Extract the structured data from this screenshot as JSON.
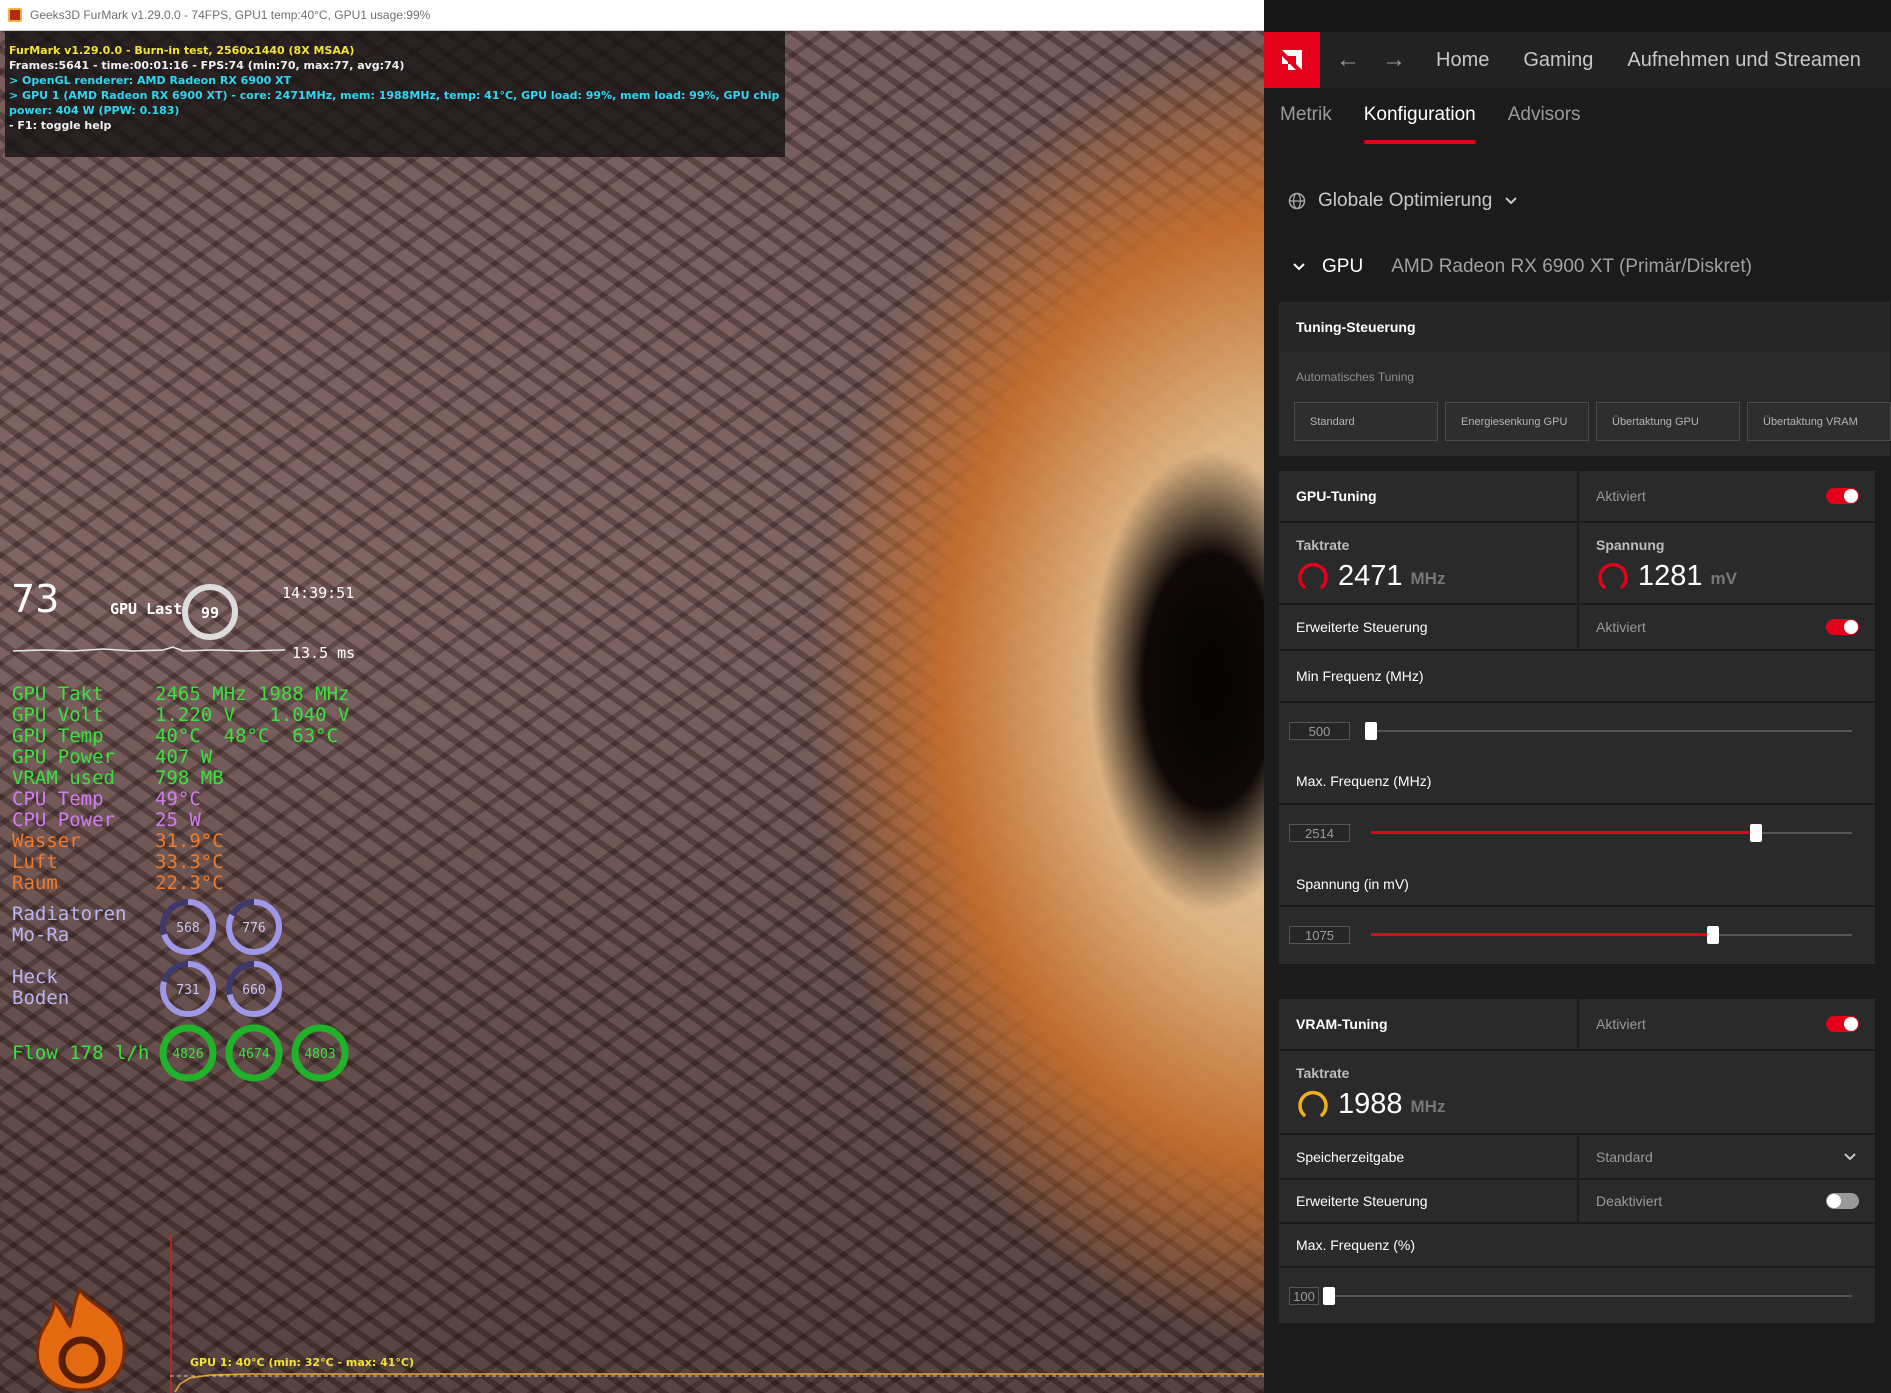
{
  "furmark": {
    "window_title": "Geeks3D FurMark v1.29.0.0 - 74FPS, GPU1 temp:40°C, GPU1 usage:99%",
    "info_lines": [
      {
        "text": "FurMark v1.29.0.0 - Burn-in test, 2560x1440 (8X MSAA)",
        "color": "#f2e33a"
      },
      {
        "text": "Frames:5641 - time:00:01:16 - FPS:74 (min:70, max:77, avg:74)",
        "color": "#f0f0f0"
      },
      {
        "text": "> OpenGL renderer: AMD Radeon RX 6900 XT",
        "color": "#31d6ef"
      },
      {
        "text": "> GPU 1 (AMD Radeon RX 6900 XT) - core: 2471MHz, mem: 1988MHz, temp: 41°C, GPU load: 99%, mem load: 99%, GPU chip power: 404 W (PPW: 0.183)",
        "color": "#31d6ef"
      },
      {
        "text": "- F1: toggle help",
        "color": "#f0f0f0"
      }
    ],
    "graph_label": "GPU 1: 40°C (min: 32°C - max: 41°C)"
  },
  "osd": {
    "fps": "73",
    "gpu_last_label": "GPU Last",
    "gpu_last_value": "99",
    "gpu_last_fraction": 0.99,
    "clock": "14:39:51",
    "frametime": "13.5 ms",
    "rows": [
      {
        "label": "GPU Takt",
        "value": "2465 MHz 1988 MHz",
        "color": "#39e23f"
      },
      {
        "label": "GPU Volt",
        "value": "1.220 V   1.040 V",
        "color": "#39e23f"
      },
      {
        "label": "GPU Temp",
        "value": "40°C  48°C  63°C",
        "color": "#39e23f"
      },
      {
        "label": "GPU Power",
        "value": "407 W",
        "color": "#39e23f"
      },
      {
        "label": "VRAM used",
        "value": "798 MB",
        "color": "#39e23f"
      },
      {
        "label": "CPU Temp",
        "value": "49°C",
        "color": "#d27df2"
      },
      {
        "label": "CPU Power",
        "value": "25 W",
        "color": "#d27df2"
      },
      {
        "label": "Wasser",
        "value": "31.9°C",
        "color": "#f07a2a"
      },
      {
        "label": "Luft",
        "value": "33.3°C",
        "color": "#f07a2a"
      },
      {
        "label": "Raum",
        "value": "22.3°C",
        "color": "#f07a2a"
      }
    ],
    "radiators_label_1": "Radiatoren",
    "radiators_label_2": "Mo-Ra",
    "rad_gauge_1": "568",
    "rad_gauge_2": "776",
    "heck_label": "Heck",
    "boden_label": "Boden",
    "hb_gauge_1": "731",
    "hb_gauge_2": "660",
    "flow_label": "Flow 178 l/h",
    "flow_gauge_1": "4826",
    "flow_gauge_2": "4674",
    "flow_gauge_3": "4803",
    "colors": {
      "green": "#39e23f",
      "violet": "#d27df2",
      "orange": "#f07a2a",
      "lavender": "#b9b4f4"
    }
  },
  "adrenalin": {
    "nav": {
      "back_icon": "arrow-left-icon",
      "forward_icon": "arrow-right-icon",
      "home": "Home",
      "gaming": "Gaming",
      "streaming": "Aufnehmen und Streamen"
    },
    "subtabs": {
      "metrics": "Metrik",
      "config": "Konfiguration",
      "advisors": "Advisors"
    },
    "scope": "Globale Optimierung",
    "gpu_label": "GPU",
    "gpu_name": "AMD Radeon RX 6900 XT (Primär/Diskret)",
    "tuning": {
      "header": "Tuning-Steuerung",
      "auto_label": "Automatisches Tuning",
      "presets": [
        "Standard",
        "Energiesenkung GPU",
        "Übertaktung GPU",
        "Übertaktung VRAM"
      ]
    },
    "gpu_tuning": {
      "label": "GPU-Tuning",
      "state": "Aktiviert",
      "clock_label": "Taktrate",
      "clock_value": "2471",
      "clock_unit": "MHz",
      "voltage_label": "Spannung",
      "voltage_value": "1281",
      "voltage_unit": "mV",
      "advanced_label": "Erweiterte Steuerung",
      "advanced_state": "Aktiviert",
      "min_freq_label": "Min Frequenz (MHz)",
      "min_freq_value": "500",
      "min_freq_fraction": 0.0,
      "max_freq_label": "Max. Frequenz (MHz)",
      "max_freq_value": "2514",
      "max_freq_fraction": 0.8,
      "voltage_slider_label": "Spannung (in mV)",
      "voltage_slider_value": "1075",
      "voltage_slider_fraction": 0.71
    },
    "vram_tuning": {
      "label": "VRAM-Tuning",
      "state": "Aktiviert",
      "clock_label": "Taktrate",
      "clock_value": "1988",
      "clock_unit": "MHz",
      "timing_label": "Speicherzeitgabe",
      "timing_value": "Standard",
      "advanced_label": "Erweiterte Steuerung",
      "advanced_state": "Deaktiviert",
      "max_freq_label": "Max. Frequenz (%)",
      "max_freq_value": "100",
      "max_freq_fraction": 0.0
    },
    "colors": {
      "accent": "#e2001a",
      "gauge_yellow": "#f2b01e"
    }
  }
}
